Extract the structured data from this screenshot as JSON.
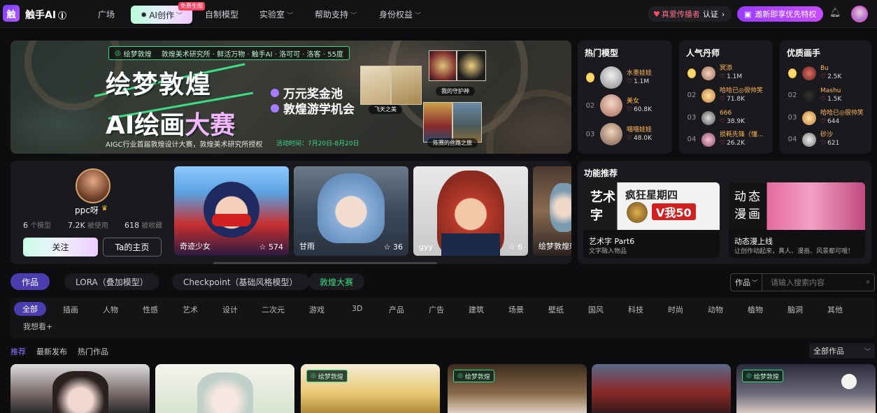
{
  "header": {
    "logo_char": "触",
    "brand": "触手AI",
    "nav": [
      {
        "label": "广场",
        "chevron": false
      },
      {
        "label": "AI创作",
        "chevron": true
      },
      {
        "label": "自制模型",
        "chevron": false
      },
      {
        "label": "实验室",
        "chevron": true
      },
      {
        "label": "帮助支持",
        "chevron": true
      },
      {
        "label": "身份权益",
        "chevron": true
      }
    ],
    "hot_tag": "免费生图",
    "promo_creator_1": "真爱传播者",
    "promo_creator_2": "认证",
    "promo_invite": "邀新即享优先特权"
  },
  "banner": {
    "top_label": "敦煌美术研究所 · 鲜活万物 · 触手AI · 洛可可 · 洛客 · 55度",
    "logo_text": "绘梦敦煌",
    "title_1": "绘梦敦煌",
    "title_2a": "AI绘画",
    "title_2b": "大赛",
    "bullet_1": "万元奖金池",
    "bullet_2": "敦煌游学机会",
    "desc": "AIGC行业首届敦煌设计大赛，敦煌美术研究所授权",
    "date": "活动时间：7月20日-8月20日",
    "captions": [
      "飞天之美",
      "我的守护神",
      "陈赛的丝路之旅"
    ]
  },
  "hot_models": {
    "title": "热门模型",
    "items": [
      {
        "rank": "1",
        "name": "水墨娃娃",
        "value": "1.1M"
      },
      {
        "rank": "02",
        "name": "美女",
        "value": "60.8K"
      },
      {
        "rank": "03",
        "name": "喵喵娃娃",
        "value": "48.0K"
      }
    ]
  },
  "popular_dan": {
    "title": "人气丹师",
    "items": [
      {
        "rank": "1",
        "name": "冥添",
        "value": "1.1M"
      },
      {
        "rank": "02",
        "name": "哈哈已◎很帅笑",
        "value": "71.8K"
      },
      {
        "rank": "03",
        "name": "666",
        "value": "38.9K"
      },
      {
        "rank": "04",
        "name": "损耗先锋（懂...",
        "value": "26.2K"
      }
    ]
  },
  "top_painters": {
    "title": "优质画手",
    "items": [
      {
        "rank": "1",
        "name": "Bu",
        "value": "2.5K"
      },
      {
        "rank": "02",
        "name": "Mashu",
        "value": "1.5K"
      },
      {
        "rank": "03",
        "name": "哈哈已◎很帅笑",
        "value": "644"
      },
      {
        "rank": "04",
        "name": "砂沙",
        "value": "621"
      }
    ]
  },
  "profile": {
    "name": "ppc呀",
    "stats": [
      {
        "num": "6",
        "label": "个模型"
      },
      {
        "num": "7.2K",
        "label": "被使用"
      },
      {
        "num": "618",
        "label": "被收藏"
      }
    ],
    "follow": "关注",
    "home": "Ta的主页",
    "models": [
      {
        "label": "奇迹少女",
        "stars": "574"
      },
      {
        "label": "甘雨",
        "stars": "36"
      },
      {
        "label": "gyy",
        "stars": "6"
      },
      {
        "label": "绘梦敦煌刺",
        "stars": ""
      }
    ]
  },
  "func": {
    "title": "功能推荐",
    "cards": [
      {
        "title": "艺术字 Part6",
        "sub": "文字融入物品",
        "art_a": "艺术",
        "art_b": "字",
        "banner": "疯狂星期四",
        "badge": "V我50"
      },
      {
        "title": "动态漫上线",
        "sub": "让创作动起来，真人、漫画、风景都可哦！",
        "art_a": "动态",
        "art_b": "漫画"
      }
    ]
  },
  "tabs": [
    "作品",
    "LORA（叠加模型）",
    "Checkpoint（基础风格模型）",
    "敦煌大赛"
  ],
  "search": {
    "select": "作品",
    "placeholder": "请输入搜索内容"
  },
  "categories": [
    "全部",
    "插画",
    "人物",
    "性感",
    "艺术",
    "设计",
    "二次元",
    "游戏",
    "3D",
    "产品",
    "广告",
    "建筑",
    "场景",
    "壁纸",
    "国风",
    "科技",
    "时尚",
    "动物",
    "植物",
    "脑洞",
    "其他",
    "我想看+"
  ],
  "subtabs": [
    "推荐",
    "最新发布",
    "热门作品"
  ],
  "all_works": "全部作品",
  "gallery_tag": "绘梦敦煌",
  "icons": {
    "star": "star-icon",
    "heart": "heart-icon",
    "bell": "bell-icon",
    "search": "search-icon"
  },
  "colors": {
    "accent": "#4b3cb0",
    "green": "#3ddc84",
    "pink": "#ff5b7a"
  }
}
